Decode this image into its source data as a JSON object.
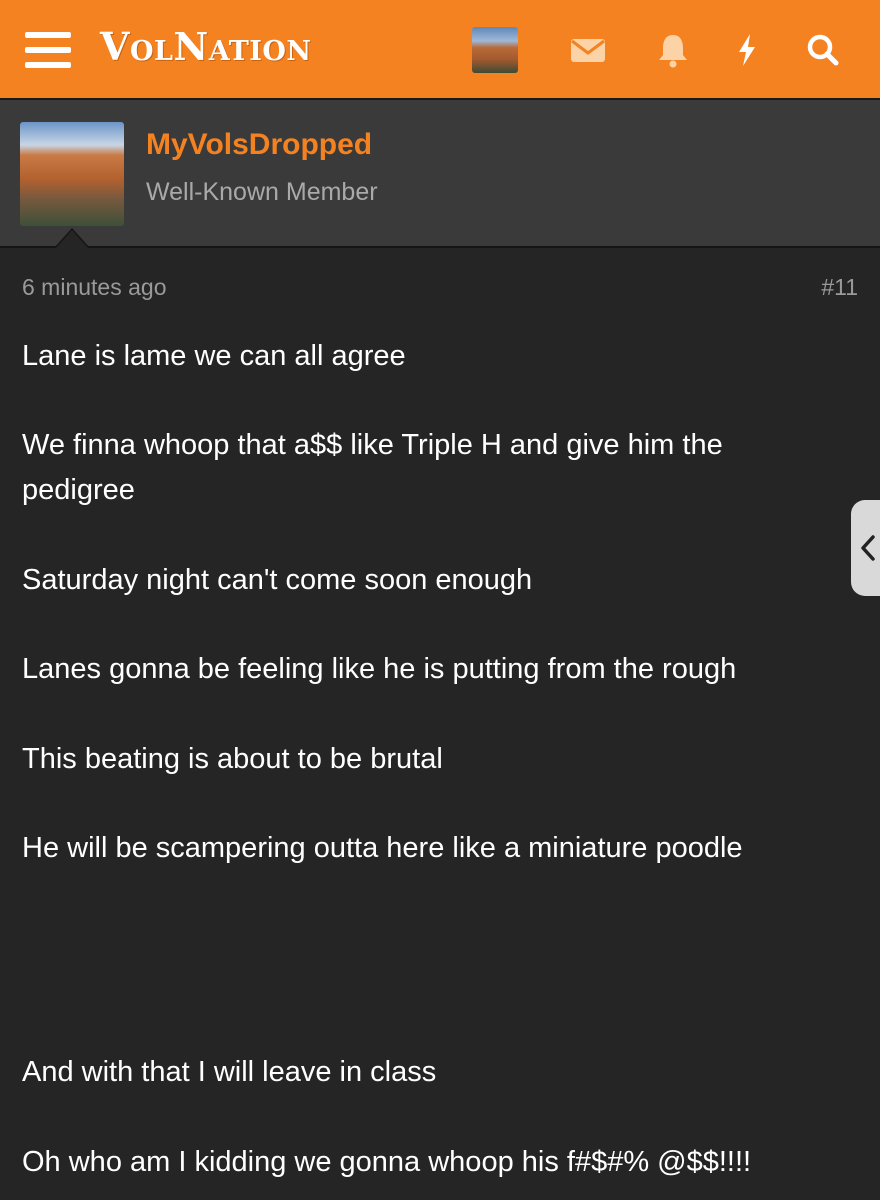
{
  "header": {
    "logo_text": "VolNation",
    "icons": [
      "menu-icon",
      "avatar",
      "envelope-icon",
      "bell-icon",
      "bolt-icon",
      "search-icon"
    ],
    "accent_color": "#f58220"
  },
  "author": {
    "name": "MyVolsDropped",
    "role": "Well-Known Member"
  },
  "post": {
    "time": "6 minutes ago",
    "number": "#11",
    "lines": [
      "Lane is lame we can all agree",
      "We finna whoop that a$$ like Triple H and give him the",
      "pedigree",
      "Saturday night can't come soon enough",
      "Lanes gonna be feeling like he is putting from the rough",
      "This beating is about to be brutal",
      "He will be scampering outta here like a miniature poodle",
      "And with that I will leave in class",
      "Oh who am I kidding we gonna whoop his f#$#% @$$!!!!"
    ]
  }
}
